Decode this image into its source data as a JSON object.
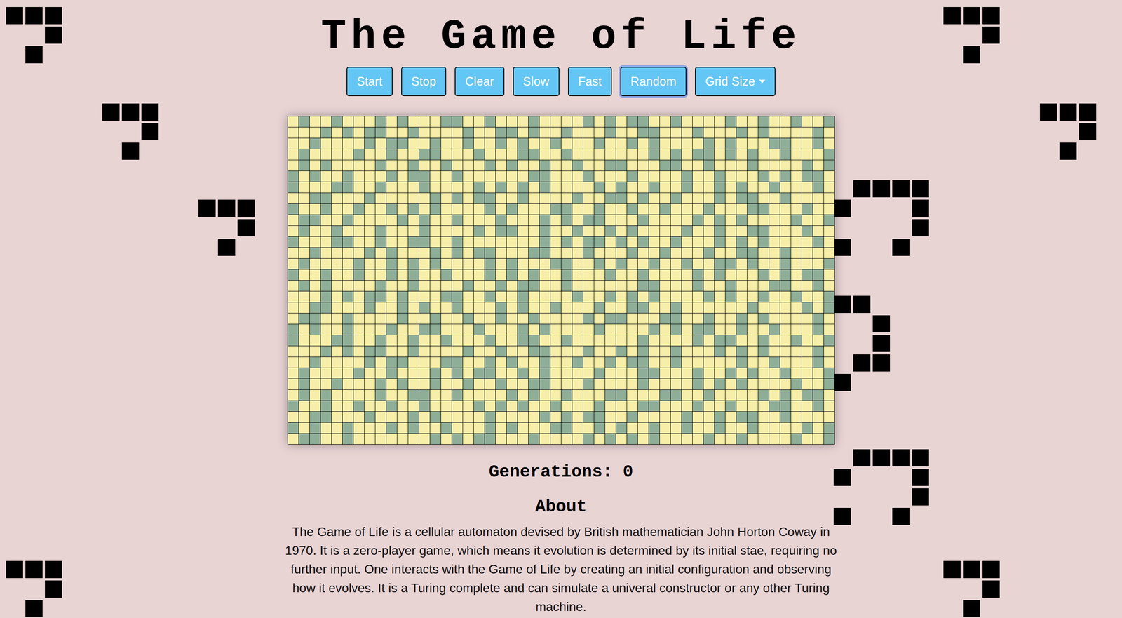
{
  "title": "The Game of Life",
  "controls": [
    {
      "label": "Start",
      "selected": false,
      "kind": "button"
    },
    {
      "label": "Stop",
      "selected": false,
      "kind": "button"
    },
    {
      "label": "Clear",
      "selected": false,
      "kind": "button"
    },
    {
      "label": "Slow",
      "selected": false,
      "kind": "button"
    },
    {
      "label": "Fast",
      "selected": false,
      "kind": "button"
    },
    {
      "label": "Random",
      "selected": true,
      "kind": "button"
    },
    {
      "label": "Grid Size",
      "selected": false,
      "kind": "dropdown"
    }
  ],
  "grid": {
    "columns": 50,
    "rows": [
      [
        ".#..#...#.",
        "#...##..#.",
        "..#....#.#",
        ".##..#....",
        "#..#..#..#"
      ],
      [
        "...#.#.##.",
        ".#....#..#",
        "#.#..#...#",
        "..##...#..",
        ".#.#....#."
      ],
      [
        "..#....#.#",
        "#..#..#..#",
        ".#..#...#.",
        ".#.#....#.",
        "#...##..#."
      ],
      [
        ".#....#..#",
        "..##...#..",
        ".##..#....",
        "...#.#.##.",
        "#.#..#...#"
      ],
      [
        ".#.#....#.",
        ".#..#...#.",
        "#..#..#..#",
        "#...##..#.",
        "..#....#.#"
      ],
      [
        "#.#..#...#",
        ".##..#....",
        "..##...#..",
        ".#....#..#",
        "...#.#.##."
      ],
      [
        "#...##..#.",
        "..#....#.#",
        ".#.#....#.",
        "#..#..#..#",
        ".#..#...#."
      ],
      [
        "..##...#..",
        "...#.#.##.",
        ".#....#..#",
        "#.#..#...#",
        ".##..#...."
      ],
      [
        "#..#..#..#",
        ".#.#....#.",
        "#...##..#.",
        ".#..#...#.",
        "..##...#.."
      ],
      [
        ".##..#....",
        "#.#..#...#",
        "...#.#.##.",
        "..#....#.#",
        ".#....#..#"
      ],
      [
        ".#..#...#.",
        "..#....#.#",
        "#..#..#..#",
        ".#....#..#",
        "..##...#.."
      ],
      [
        "#...##..#.",
        ".##..#....",
        "...#.#.##.",
        "#.#..#...#",
        ".#.#....#."
      ],
      [
        "..#....#.#",
        "...#.#.##.",
        "..##...#..",
        ".#..#...#.",
        ".##..#...."
      ],
      [
        ".#....#..#",
        ".#.#....#.",
        "#...##..#.",
        "#..#..#..#",
        "#.#..#...#"
      ],
      [
        "#..#..#..#",
        ".#..#...#.",
        "#.#..#...#",
        "..#....#.#",
        "...#.#.##."
      ],
      [
        ".#.#....#.",
        ".#....#..#",
        ".##..#....",
        "..##...#..",
        "#...##..#."
      ],
      [
        "...#.#.##.",
        "#...##..#.",
        ".#....#..#",
        ".#.#....#.",
        "#..#..#..#"
      ],
      [
        "..##...#..",
        "#.#..#...#",
        ".#..#...#.",
        ".##..#....",
        "..#....#.#"
      ],
      [
        ".##..#....",
        "#..#..#..#",
        "..#....#.#",
        "#...##..#.",
        ".#.#....#."
      ],
      [
        "#.#..#...#",
        "..##...#..",
        ".#.#....#.",
        "...#.#.##.",
        ".#..#...#."
      ],
      [
        "#...##..#.",
        ".#..#...#.",
        ".##..#....",
        "..#....#.#",
        "#..#..#..#"
      ],
      [
        "...#.#.##.",
        ".#....#..#",
        "..##...#..",
        "#.#..#...#",
        ".#.#....#."
      ],
      [
        "..#....#.#",
        "#...##..#.",
        "#..#..#..#",
        ".##..#....",
        ".#..#...#."
      ],
      [
        ".#....#..#",
        "...#.#.##.",
        ".#.#....#.",
        "..##...#..",
        "#.#..#...#"
      ],
      [
        ".#..#...#.",
        "#..#..#..#",
        "..##...#..",
        "..#....#.#",
        ".#....#..#"
      ],
      [
        ".#.#....#.",
        ".##..#....",
        "#.#..#...#",
        "#...##..#.",
        "...#.#.##."
      ],
      [
        "#..#..#..#",
        "..#....#.#",
        ".#..#...#.",
        "..##...#..",
        "#...##..#."
      ],
      [
        "..##...#..",
        ".#.#....#.",
        "...#.#.##.",
        ".#....#..#",
        ".##..#...."
      ],
      [
        "#.#..#...#",
        ".#..#...#.",
        "#...##..#.",
        "#..#..#..#",
        "..#....#.#"
      ],
      [
        ".##..#....",
        "...#.#.##.",
        "..#....#.#",
        ".#.#....#.",
        ".#....#..#"
      ]
    ]
  },
  "generations": {
    "label": "Generations:",
    "value": "0"
  },
  "about": {
    "heading": "About",
    "text": "The Game of Life is a cellular automaton devised by British mathematician John Horton Coway in 1970. It is a zero-player game, which means it evolution is determined by its initial stae, requiring no further input. One interacts with the Game of Life by creating an initial configuration and observing how it evolves. It is a Turing complete and can simulate a univeral constructor or any other Turing machine."
  }
}
